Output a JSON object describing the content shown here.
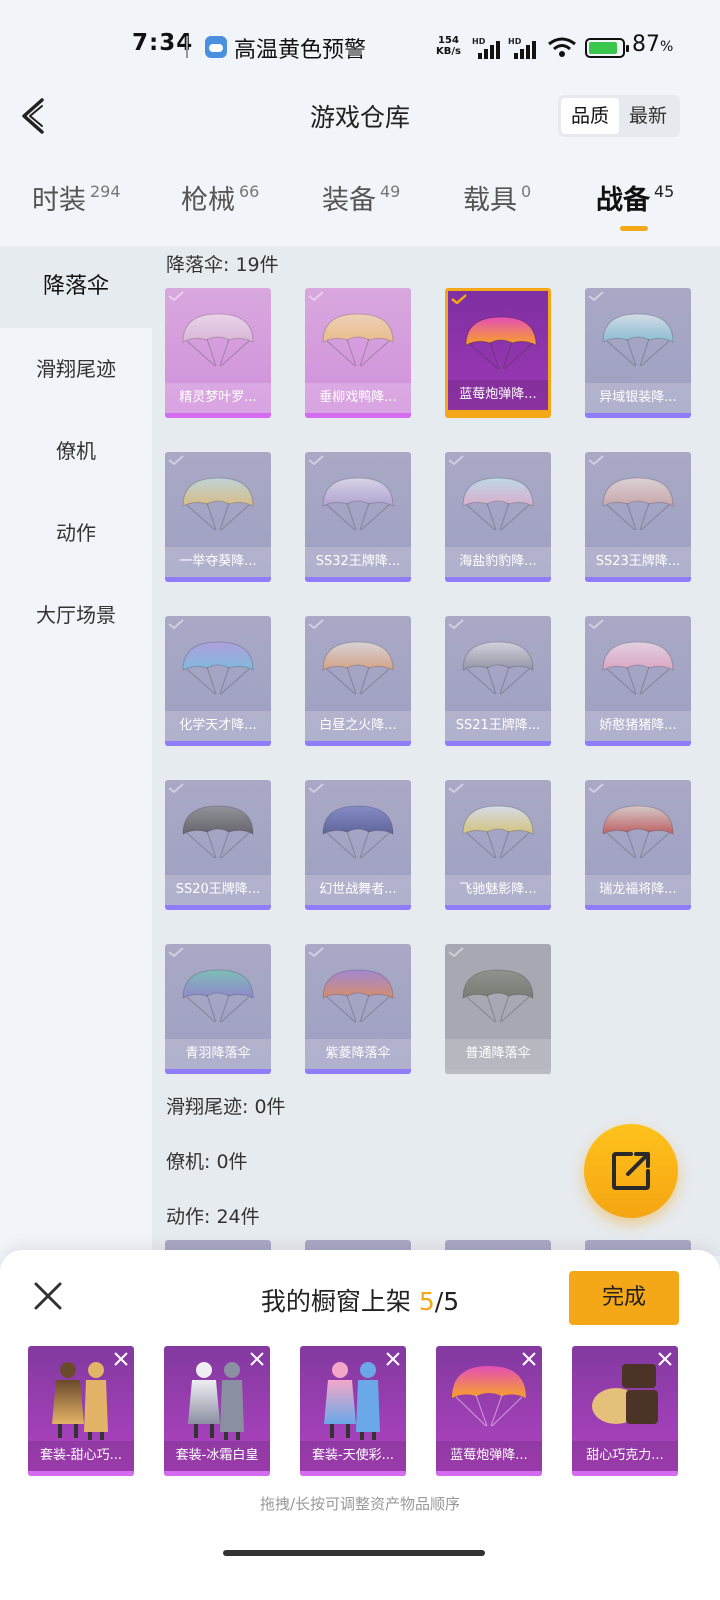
{
  "status_bar": {
    "time": "7:34",
    "alert": "高温黄色预警",
    "net_speed_value": "154",
    "net_speed_unit": "KB/s",
    "signal_label": "HD",
    "battery_percent": "87",
    "battery_unit": "%",
    "battery_level": 0.87
  },
  "header": {
    "title": "游戏仓库",
    "sort_options": [
      "品质",
      "最新"
    ],
    "sort_selected": "品质"
  },
  "tabs": [
    {
      "label": "时装",
      "count": "294"
    },
    {
      "label": "枪械",
      "count": "66"
    },
    {
      "label": "装备",
      "count": "49"
    },
    {
      "label": "载具",
      "count": "0"
    },
    {
      "label": "战备",
      "count": "45",
      "active": true
    }
  ],
  "sidebar": {
    "items": [
      "降落伞",
      "滑翔尾迹",
      "僚机",
      "动作",
      "大厅场景"
    ],
    "active": "降落伞"
  },
  "content": {
    "sections": {
      "parachute": "降落伞: 19件",
      "glide_trail": "滑翔尾迹: 0件",
      "wingman": "僚机: 0件",
      "emote": "动作: 24件"
    },
    "parachutes": [
      {
        "name": "精灵梦叶罗...",
        "rarity": "pink",
        "colors": [
          "#f4eaf0",
          "#d8c0d0"
        ]
      },
      {
        "name": "垂柳戏鸭降...",
        "rarity": "pink",
        "colors": [
          "#f6e4a8",
          "#f2c969"
        ]
      },
      {
        "name": "蓝莓炮弹降...",
        "rarity": "selected",
        "colors": [
          "#e44fb8",
          "#f7a227"
        ]
      },
      {
        "name": "异域银装降...",
        "rarity": "purple",
        "colors": [
          "#e7f2f6",
          "#7ec7d8"
        ]
      },
      {
        "name": "一举夺葵降...",
        "rarity": "purple",
        "colors": [
          "#c9e6e0",
          "#efc76a"
        ]
      },
      {
        "name": "SS32王牌降...",
        "rarity": "purple",
        "colors": [
          "#ece6f4",
          "#b7a2d6"
        ]
      },
      {
        "name": "海盐豹豹降...",
        "rarity": "purple",
        "colors": [
          "#c8ecf3",
          "#f0b2d0"
        ]
      },
      {
        "name": "SS23王牌降...",
        "rarity": "purple",
        "colors": [
          "#f3e2dc",
          "#d6a89f"
        ]
      },
      {
        "name": "化学天才降...",
        "rarity": "purple",
        "colors": [
          "#b19de6",
          "#72c3e6"
        ]
      },
      {
        "name": "白昼之火降...",
        "rarity": "purple",
        "colors": [
          "#efe6e0",
          "#e7a16b"
        ]
      },
      {
        "name": "SS21王牌降...",
        "rarity": "purple",
        "colors": [
          "#e2e4e8",
          "#8b8f98"
        ]
      },
      {
        "name": "娇憨猪猪降...",
        "rarity": "purple",
        "colors": [
          "#fbe3ec",
          "#f0a5bf"
        ]
      },
      {
        "name": "SS20王牌降...",
        "rarity": "purple",
        "colors": [
          "#8a8a88",
          "#4d4b48"
        ]
      },
      {
        "name": "幻世战舞者...",
        "rarity": "purple",
        "colors": [
          "#7880c8",
          "#454a8a"
        ]
      },
      {
        "name": "飞驰魅影降...",
        "rarity": "purple",
        "colors": [
          "#e9f4f7",
          "#e7d060"
        ]
      },
      {
        "name": "瑞龙福将降...",
        "rarity": "purple",
        "colors": [
          "#e9d8c8",
          "#c8443b"
        ]
      },
      {
        "name": "青羽降落伞",
        "rarity": "purple",
        "colors": [
          "#6dc8b0",
          "#8a7bcf"
        ]
      },
      {
        "name": "紫菱降落伞",
        "rarity": "purple",
        "colors": [
          "#a17ad6",
          "#e8854a"
        ]
      },
      {
        "name": "普通降落伞",
        "rarity": "gray",
        "colors": [
          "#858b7c",
          "#646b5c"
        ]
      }
    ]
  },
  "bottom_sheet": {
    "title": "我的橱窗上架",
    "current": "5",
    "separator": "/",
    "total": "5",
    "done_label": "完成",
    "hint": "拖拽/长按可调整资产物品顺序",
    "slots": [
      {
        "name": "套装-甜心巧...",
        "art": "outfit",
        "colors": [
          "#6b4a2c",
          "#e3b467"
        ]
      },
      {
        "name": "套装-冰霜白皇",
        "art": "outfit",
        "colors": [
          "#eeeef2",
          "#8b8fa2"
        ]
      },
      {
        "name": "套装-天使彩...",
        "art": "outfit",
        "colors": [
          "#f3a7c8",
          "#6aa8e8"
        ]
      },
      {
        "name": "蓝莓炮弹降...",
        "art": "parachute",
        "colors": [
          "#e44fb8",
          "#f7a227"
        ]
      },
      {
        "name": "甜心巧克力...",
        "art": "chest",
        "colors": [
          "#e4c07a",
          "#4b3325"
        ]
      }
    ]
  }
}
